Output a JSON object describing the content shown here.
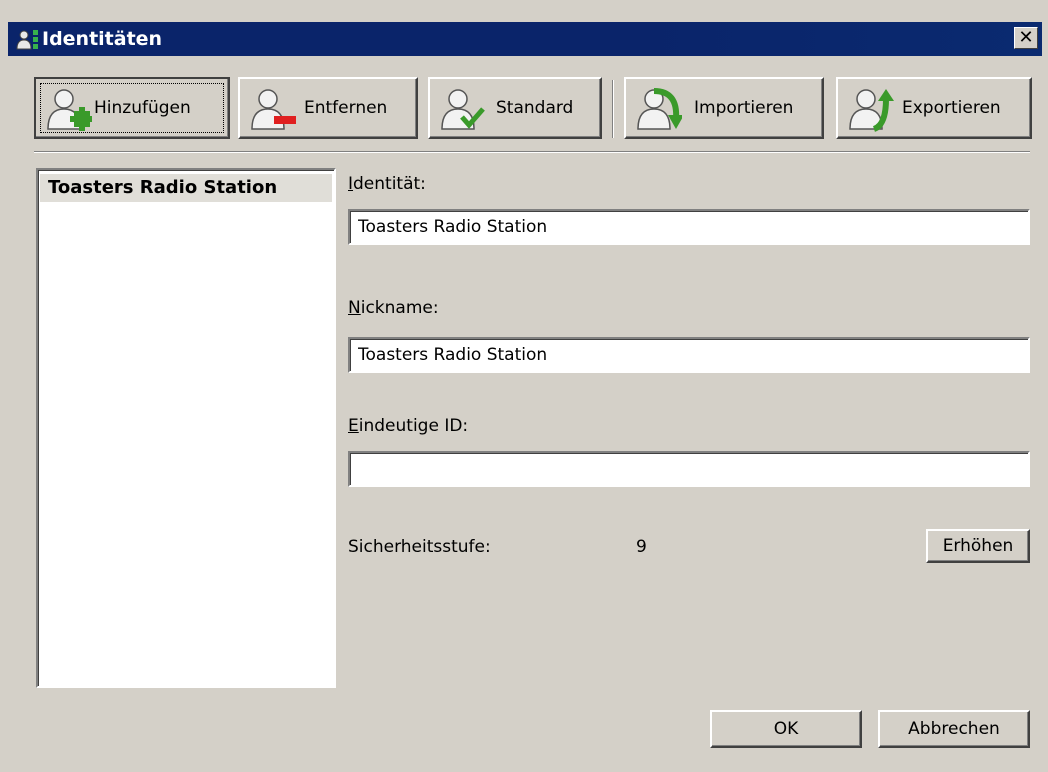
{
  "window": {
    "title": "Identitäten",
    "close_glyph": "✕"
  },
  "toolbar": {
    "buttons": [
      {
        "label": "Hinzufügen",
        "icon": "user-add-icon"
      },
      {
        "label": "Entfernen",
        "icon": "user-remove-icon"
      },
      {
        "label": "Standard",
        "icon": "user-default-icon"
      },
      {
        "label": "Importieren",
        "icon": "user-import-icon"
      },
      {
        "label": "Exportieren",
        "icon": "user-export-icon"
      }
    ]
  },
  "identities": {
    "items": [
      "Toasters Radio Station"
    ],
    "selected_index": 0
  },
  "form": {
    "identity_label_mnemonic": "I",
    "identity_label_rest": "dentität:",
    "identity_value": "Toasters Radio Station",
    "nickname_label_mnemonic": "N",
    "nickname_label_rest": "ickname:",
    "nickname_value": "Toasters Radio Station",
    "uid_label_mnemonic": "E",
    "uid_label_rest": "indeutige ID:",
    "uid_value": "",
    "security_label": "Sicherheitsstufe:",
    "security_value": "9",
    "raise_button": "Erhöhen"
  },
  "dialog": {
    "ok": "OK",
    "cancel": "Abbrechen"
  },
  "colors": {
    "titlebar": "#0a246a",
    "face": "#d4d0c8",
    "accent_green": "#3a9a2a",
    "remove_red": "#e02020"
  }
}
